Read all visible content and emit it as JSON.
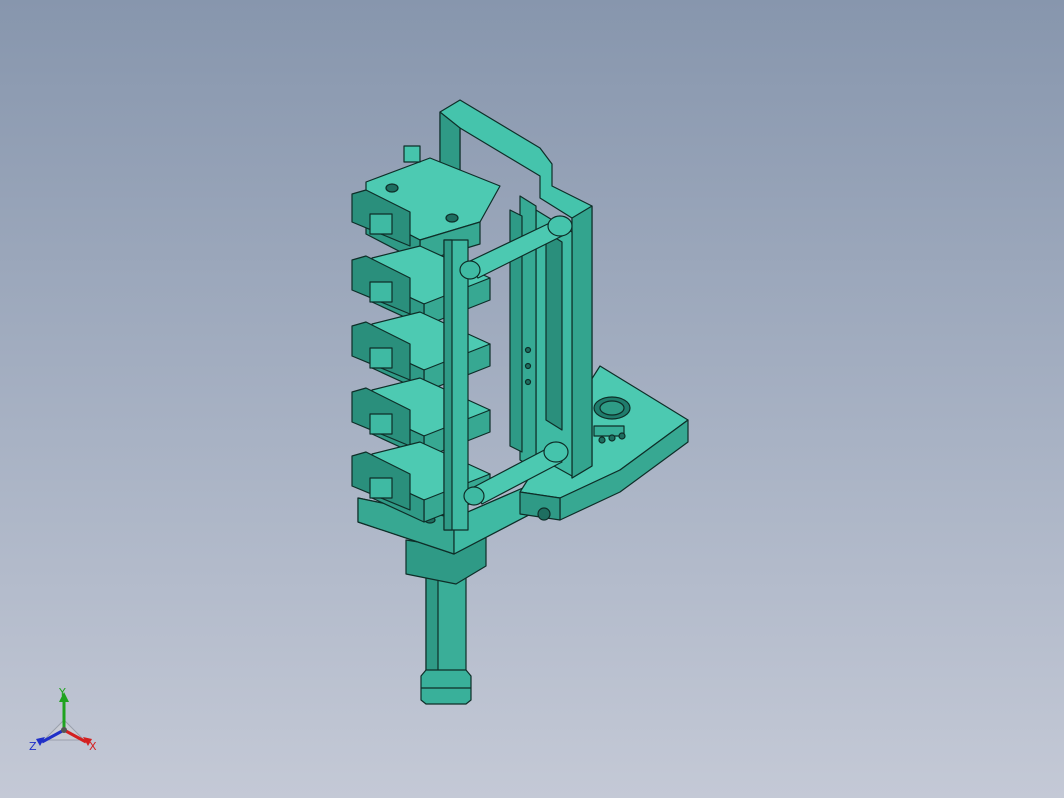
{
  "viewport": {
    "background_top": "#8796ad",
    "background_bottom": "#c4c9d6",
    "model_color": "#3fbfa6",
    "model_edge_color": "#0e2e28"
  },
  "triad": {
    "y_label": "Y",
    "x_label": "X",
    "z_label": "Z",
    "y_color": "#1fa31f",
    "x_color": "#d42020",
    "z_color": "#2030c8"
  }
}
